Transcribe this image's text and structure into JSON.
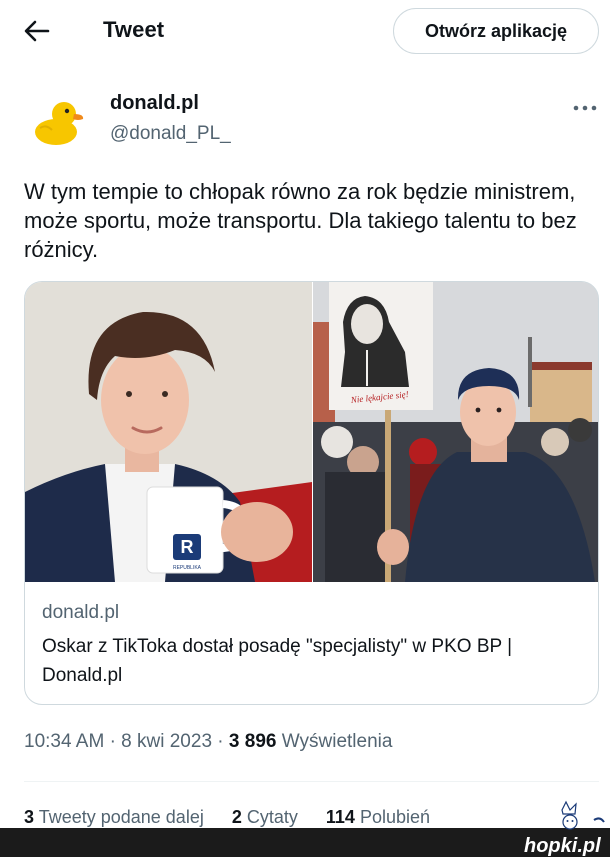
{
  "header": {
    "title": "Tweet",
    "open_app_label": "Otwórz aplikację",
    "back_icon": "arrow-left-icon"
  },
  "author": {
    "display_name": "donald.pl",
    "handle": "@donald_PL_",
    "avatar_icon": "rubber-duck-logo",
    "more_icon": "more-horizontal-icon"
  },
  "tweet": {
    "text": "W tym tempie to chłopak równo za rok będzie ministrem, może sportu, może transportu. Dla takiego talentu to bez różnicy."
  },
  "card": {
    "image_left_alt": "young man holding a mug",
    "image_right_alt": "young man at a street demonstration",
    "sign_text": "Nie lękajcie się!",
    "mug_brand": "REPUBLIKA",
    "domain": "donald.pl",
    "title": "Oskar z TikToka dostał posadę \"specjalisty\" w PKO BP | Donald.pl"
  },
  "meta": {
    "time": "10:34 AM",
    "separator": "·",
    "date": "8 kwi 2023",
    "views_count": "3 896",
    "views_label": "Wyświetlenia"
  },
  "stats": {
    "retweets_count": "3",
    "retweets_label": "Tweety podane dalej",
    "quotes_count": "2",
    "quotes_label": "Cytaty",
    "likes_count": "114",
    "likes_label": "Polubień"
  },
  "watermark": {
    "text": "hopki.pl"
  },
  "colors": {
    "text_primary": "#0f1419",
    "text_secondary": "#536471",
    "border": "#cfd9de",
    "duck_yellow": "#f7c600",
    "duck_beak": "#f08a1c"
  }
}
